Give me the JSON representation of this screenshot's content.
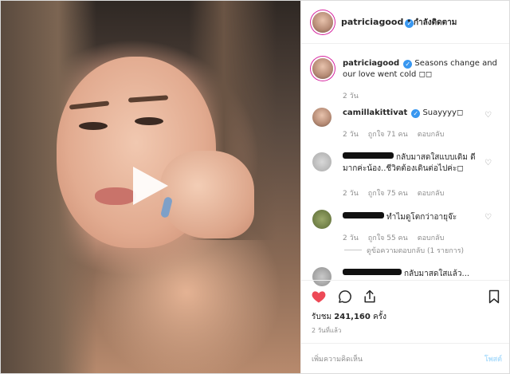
{
  "header": {
    "username": "patriciagood",
    "separator": "•",
    "follow_label": "กำลังติดตาม"
  },
  "caption": {
    "username": "patriciagood",
    "text": "Seasons change and our love went cold",
    "time": "2 วัน"
  },
  "comments": [
    {
      "username": "camillakittivat",
      "text": "Suayyyy",
      "time": "2 วัน",
      "likes": "ถูกใจ 71 คน",
      "reply_label": "ตอบกลับ"
    },
    {
      "username": "",
      "text": "กลับมาสดใสแบบเดิม ดีมากค่ะน้อง..ชีวิตต้องเดินต่อไปค่ะ",
      "time": "2 วัน",
      "likes": "ถูกใจ 75 คน",
      "reply_label": "ตอบกลับ"
    },
    {
      "username": "",
      "text": "ทำไมดูโตกว่าอายุจ๊ะ",
      "time": "2 วัน",
      "likes": "ถูกใจ 55 คน",
      "reply_label": "ตอบกลับ"
    },
    {
      "username": "",
      "text": "กลับมาสดใสแล้ว...",
      "time": "",
      "likes": "",
      "reply_label": ""
    }
  ],
  "view_replies": "ดูข้อความตอบกลับ (1 รายการ)",
  "actions": {
    "views_label": "รับชม",
    "views_count": "241,160",
    "views_unit": "ครั้ง",
    "date": "2 วันที่แล้ว"
  },
  "add_comment": {
    "placeholder": "เพิ่มความคิดเห็น",
    "post_label": "โพสต์"
  },
  "icons": [
    "play-icon",
    "heart-icon",
    "comment-icon",
    "share-icon",
    "bookmark-icon",
    "verified-icon",
    "more-icon"
  ],
  "colors": {
    "like_red": "#ed4956",
    "verified_blue": "#3897f0",
    "post_disabled": "#b2dffc"
  }
}
